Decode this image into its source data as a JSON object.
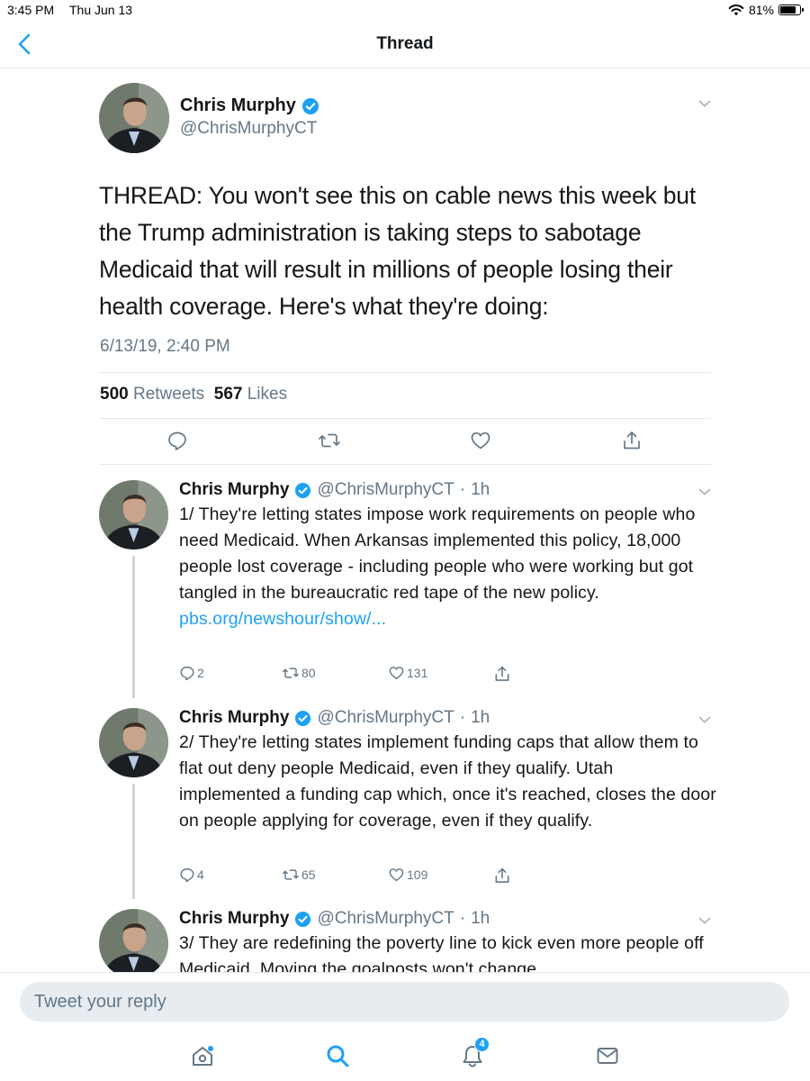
{
  "status": {
    "time": "3:45 PM",
    "date": "Thu Jun 13",
    "battery": "81%",
    "battery_level": 0.81
  },
  "nav": {
    "title": "Thread"
  },
  "main_tweet": {
    "name": "Chris Murphy",
    "handle": "@ChrisMurphyCT",
    "text": "THREAD: You won't see this on cable news this week but the Trump administration is taking steps to sabotage Medicaid that will result in millions of people losing their health coverage. Here's what they're doing:",
    "timestamp": "6/13/19, 2:40 PM",
    "retweets": "500",
    "retweets_label": "Retweets",
    "likes": "567",
    "likes_label": "Likes"
  },
  "replies": [
    {
      "name": "Chris Murphy",
      "handle": "@ChrisMurphyCT",
      "time": "1h",
      "text": "1/ They're letting states impose work requirements on people who need Medicaid. When Arkansas implemented this policy, 18,000 people lost coverage - including people who were working but got tangled in the bureaucratic red tape of the new policy.",
      "link": "pbs.org/newshour/show/...",
      "reply_count": "2",
      "retweet_count": "80",
      "like_count": "131"
    },
    {
      "name": "Chris Murphy",
      "handle": "@ChrisMurphyCT",
      "time": "1h",
      "text": "2/ They're letting states implement funding caps that allow them to flat out deny people Medicaid, even if they qualify. Utah implemented a funding cap which, once it's reached, closes the door on people applying for coverage, even if they qualify.",
      "reply_count": "4",
      "retweet_count": "65",
      "like_count": "109"
    },
    {
      "name": "Chris Murphy",
      "handle": "@ChrisMurphyCT",
      "time": "1h",
      "text": "3/ They are redefining the poverty line to kick even more people off Medicaid. Moving the goalposts won't change"
    }
  ],
  "compose": {
    "placeholder": "Tweet your reply"
  },
  "tabs": {
    "notifications_badge": "4"
  },
  "colors": {
    "accent": "#1da1f2",
    "secondary_text": "#657786",
    "divider": "#e1e8ed",
    "input_bg": "#e6ecf0"
  },
  "icons": [
    "back-chevron-icon",
    "wifi-icon",
    "battery-icon",
    "verified-icon",
    "chevron-down-icon",
    "reply-icon",
    "retweet-icon",
    "like-icon",
    "share-icon",
    "home-icon",
    "search-icon",
    "notifications-icon",
    "messages-icon"
  ]
}
